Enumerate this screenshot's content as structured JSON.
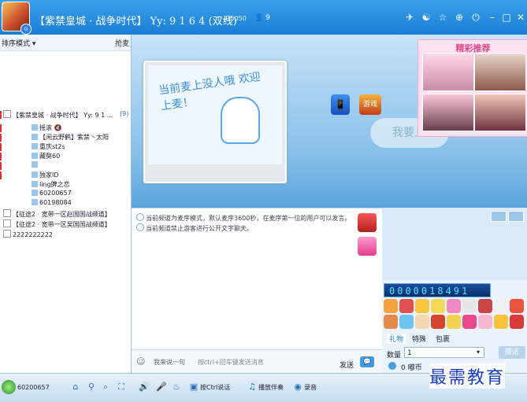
{
  "title_bar": {
    "channel_title": "【紫禁皇城 · 战争时代】 Yy: 9 1 6 4 (双线)",
    "channel_id": "ID5050",
    "user_count": "9",
    "avatar_badge": "⊙",
    "buttons": [
      "share",
      "settings",
      "favorite",
      "gift",
      "power",
      "minimize",
      "maximize",
      "close"
    ]
  },
  "left_panel": {
    "mode_label": "排序模式 ▾",
    "grab_label": "抢麦",
    "channels": [
      {
        "text": "【紫禁皇城 · 战争时代】 Yy: 9 1 ...",
        "badge": "(9)",
        "red": true,
        "level": 0
      },
      {
        "text": "摇滚 🔇",
        "red": true,
        "level": 1
      },
      {
        "text": "【闲云野鹤】紫禁丶太阳",
        "red": true,
        "level": 1
      },
      {
        "text": "重庆st2s",
        "red": true,
        "level": 1
      },
      {
        "text": "藏獒60",
        "red": true,
        "level": 1
      },
      {
        "text": "",
        "red": true,
        "level": 1
      },
      {
        "text": "独家ID",
        "red": true,
        "level": 1
      },
      {
        "text": "ling脾之恋",
        "red": false,
        "level": 1
      },
      {
        "text": "60200657",
        "red": false,
        "level": 1
      },
      {
        "text": "60198084",
        "red": false,
        "level": 1
      },
      {
        "text": "【征途2 · 宽带一区赵国国战频道】",
        "red": false,
        "level": 0
      },
      {
        "text": "【征途2 · 宽带一区吴国国战频道】",
        "red": false,
        "level": 0
      },
      {
        "text": "2222222222",
        "red": false,
        "level": 0
      }
    ]
  },
  "stage": {
    "board_text": "当前麦上没人哦 欢迎上麦！",
    "mic_text": "我要上麦",
    "phone_icon": "📱",
    "game_icon": "游戏",
    "recommend_title": "精彩推荐"
  },
  "chat": {
    "messages": [
      "当前频道为麦序模式，默认麦序3600秒，在麦序第一位的用户可以发言。",
      "当前频道禁止游客进行公开文字聊天。"
    ],
    "input_placeholder": "我来说一句",
    "input_hint": "按ctrl+回车键发送消息",
    "send_label": "发送",
    "send_icon": "💬"
  },
  "gift_panel": {
    "counter": "0000018491",
    "tabs": [
      "礼物",
      "特殊",
      "包裹"
    ],
    "qty_label": "数量",
    "qty_value": "1",
    "send_button": "赠送",
    "coin_text": "0 嘟币"
  },
  "bottom_bar": {
    "user_id": "60200657",
    "ctrl_talk": "按Ctrl说话",
    "accompany": "播放伴奏",
    "record": "录音"
  },
  "watermark": "最需教育",
  "colors": {
    "accent": "#1b7ed6",
    "red_marker": "#e03030",
    "counter_text": "#49e9ff"
  }
}
